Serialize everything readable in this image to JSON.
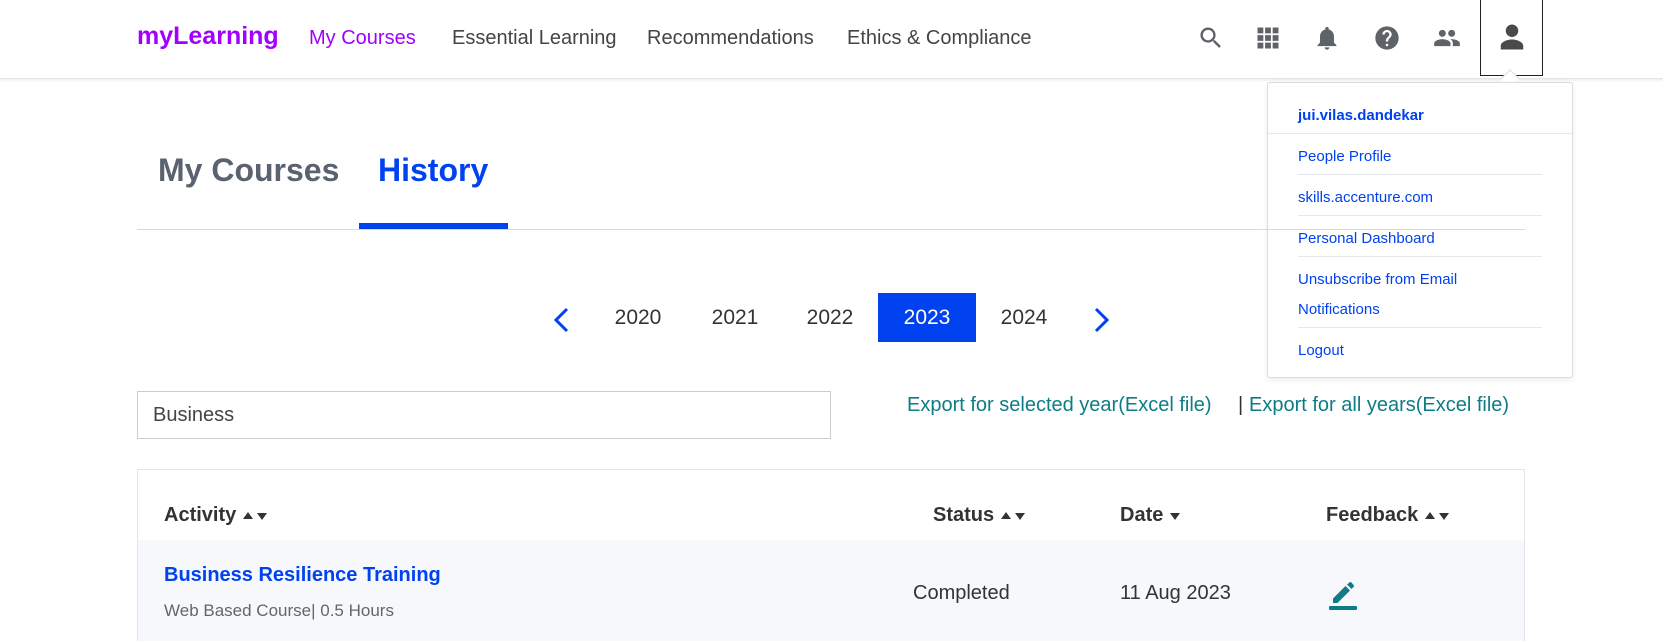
{
  "brand": "myLearning",
  "nav": {
    "links": [
      "My Courses",
      "Essential Learning",
      "Recommendations",
      "Ethics & Compliance"
    ]
  },
  "icons": {
    "search": "search-icon",
    "apps": "apps-grid-icon",
    "notifications": "bell-icon",
    "help": "help-icon",
    "people": "people-icon",
    "profile": "user-icon"
  },
  "profile_menu": {
    "username": "jui.vilas.dandekar",
    "items": [
      "People Profile",
      "skills.accenture.com",
      "Personal Dashboard",
      "Unsubscribe from Email",
      "Notifications",
      "Logout"
    ]
  },
  "tabs": [
    "My Courses",
    "History"
  ],
  "years": {
    "items": [
      "2020",
      "2021",
      "2022",
      "2023",
      "2024"
    ],
    "selected": "2023"
  },
  "search": {
    "value": "Business"
  },
  "export": {
    "selected_year": "Export for selected year(Excel file)",
    "separator": "|",
    "all_years": "Export for all years(Excel file)"
  },
  "table": {
    "headers": [
      "Activity",
      "Status",
      "Date",
      "Feedback"
    ],
    "rows": [
      {
        "title": "Business Resilience Training",
        "meta": "Web Based Course| 0.5 Hours",
        "status": "Completed",
        "date": "11 Aug 2023"
      }
    ]
  },
  "colors": {
    "brand": "#a100ff",
    "accent": "#0041f0",
    "export_link": "#0e7c86",
    "edit_icon": "#0e7c86"
  }
}
